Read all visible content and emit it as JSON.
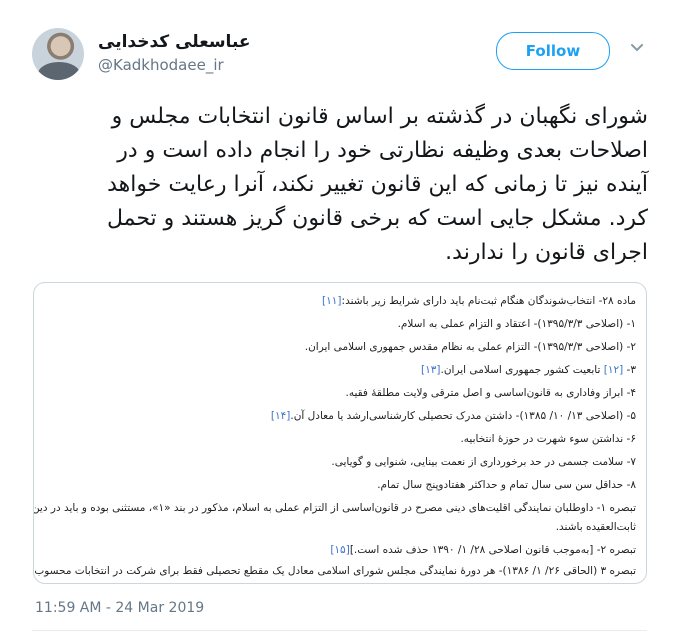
{
  "user": {
    "display_name": "عباسعلی کدخدایی",
    "handle": "@Kadkhodaee_ir"
  },
  "follow_button": {
    "label": "Follow"
  },
  "tweet": {
    "lines": [
      "شورای نگهبان در گذشته بر اساس قانون انتخابات مجلس و",
      "اصلاحات بعدی وظیفه نظارتی خود را انجام داده است و در",
      "آینده نیز تا زمانی که این قانون تغییر نکند، آنرا رعایت خواهد",
      "کرد. مشکل جایی است که برخی قانون گریز هستند و تحمل",
      "اجرای قانون را ندارند."
    ]
  },
  "card": {
    "lines": [
      {
        "text": "ماده ۲۸- انتخاب‌شوندگان هنگام ثبت‌نام باید دارای شرایط زیر باشند:",
        "ref": "[۱۱]"
      },
      {
        "text": "۱- (اصلاحی ۱۳۹۵/۳/۳)- اعتقاد و التزام عملی به اسلام.",
        "ref": ""
      },
      {
        "text": "۲- (اصلاحی ۱۳۹۵/۳/۳)- التزام عملی به نظام مقدس جمهوری اسلامی ایران.",
        "ref": ""
      },
      {
        "text": "۳- ",
        "ref": "[۱۲]",
        "text2": " تابعیت کشور جمهوری اسلامی ایران.",
        "ref2": "[۱۳]"
      },
      {
        "text": "۴- ابراز وفاداری به قانون‌اساسی و اصل مترقی ولایت مطلقهٔ فقیه.",
        "ref": ""
      },
      {
        "text": "۵- (اصلاحی ۱۳/ ۱۰/ ۱۳۸۵)- داشتن مدرک تحصیلی کارشناسی‌ارشد یا معادل آن.",
        "ref": "[۱۴]"
      },
      {
        "text": "۶- نداشتن سوء شهرت در حوزهٔ انتخابیه.",
        "ref": ""
      },
      {
        "text": "۷- سلامت جسمی در حد برخورداری از نعمت بینایی، شنوایی و گویایی.",
        "ref": ""
      },
      {
        "text": "۸- حداقل سن سی سال تمام و حداکثر هفتادوپنج سال تمام.",
        "ref": ""
      },
      {
        "text": "تبصره ۱- داوطلبان نمایندگی اقلیت‌های دینی مصرح در قانون‌اساسی از التزام عملی به اسلام، مذکور در بند «۱»، مستثنی بوده و باید در دین خود",
        "ref": ""
      },
      {
        "text": "ثابت‌العقیده باشند.",
        "ref": ""
      },
      {
        "text": "تبصره ۲- [به‌موجب قانون اصلاحی ۲۸/ ۱/ ۱۳۹۰ حذف شده است.]",
        "ref": "[۱۵]"
      },
      {
        "text": "تبصره ۳ (الحاقی ۲۶/ ۱/ ۱۳۸۶)- هر دورهٔ نمایندگی مجلس شورای اسلامی معادل یک مقطع تحصیلی فقط برای شرکت در انتخابات محسوب",
        "ref": ""
      }
    ]
  },
  "timestamp": "11:59 AM - 24 Mar 2019",
  "icons": {
    "avatar": "avatar-photo",
    "menu": "chevron-down-icon"
  },
  "colors": {
    "accent": "#1da1f2",
    "secondary_text": "#657786",
    "link": "#3a74c9"
  }
}
